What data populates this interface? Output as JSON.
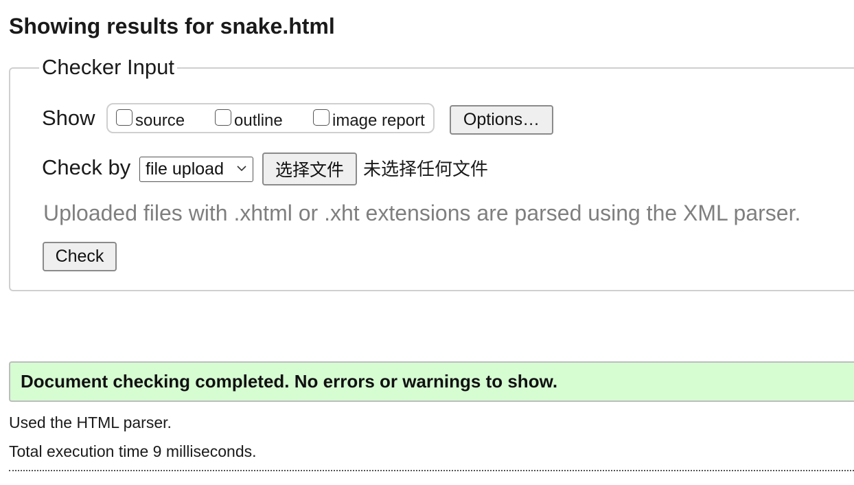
{
  "page": {
    "title": "Showing results for snake.html"
  },
  "checker": {
    "legend": "Checker Input",
    "show_label": "Show",
    "show_options": [
      {
        "label": "source",
        "checked": false
      },
      {
        "label": "outline",
        "checked": false
      },
      {
        "label": "image report",
        "checked": false
      }
    ],
    "options_button": "Options…",
    "check_by_label": "Check by",
    "check_by_select": {
      "selected": "file upload"
    },
    "file_button": "选择文件",
    "no_file_text": "未选择任何文件",
    "hint": "Uploaded files with .xhtml or .xht extensions are parsed using the XML parser.",
    "check_button": "Check"
  },
  "results": {
    "status_message": "Document checking completed. No errors or warnings to show.",
    "status_color": "#d6fcd2",
    "parser_line": "Used the HTML parser.",
    "time_line": "Total execution time 9 milliseconds."
  }
}
